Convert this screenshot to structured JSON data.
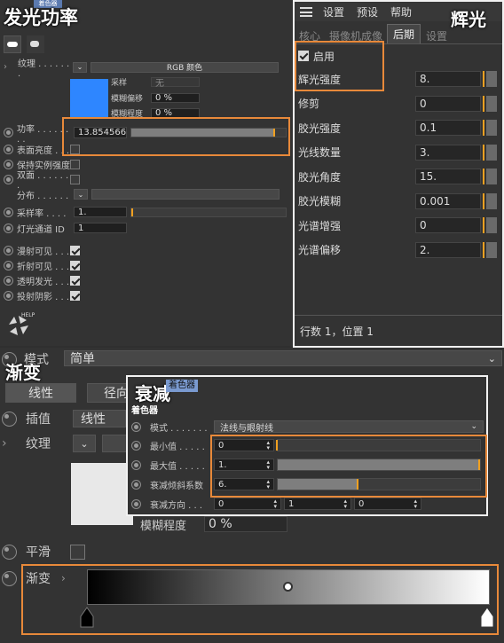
{
  "headings": {
    "glow_power": "发光功率",
    "glow": "辉光",
    "gradient": "渐变",
    "falloff": "衰减"
  },
  "left_panel": {
    "badge": "着色器",
    "texture_label": "纹理 . . . . . . .",
    "texture_mode": "RGB 颜色",
    "sampling_label": "采样",
    "sampling_value": "无",
    "blur_offset_label": "模糊偏移",
    "blur_offset_value": "0 %",
    "blur_degree_label": "模糊程度",
    "blur_degree_value": "0 %",
    "power_label": "功率 . . . . . . . .",
    "power_value": "13.854566",
    "power_level": 0.93,
    "surface_brightness_label": "表面亮度 . . .",
    "keep_instance_label": "保持实例强度",
    "double_side_label": "双面 . . . . . . .",
    "distribution_label": "分布 . . . . . .",
    "sample_rate_label": "采样率 . . . .",
    "sample_rate_value": "1.",
    "light_channel_label": "灯光通道 ID",
    "light_channel_value": "1",
    "diffuse_visible_label": "漫射可见 . . .",
    "refract_visible_label": "折射可见 . . .",
    "transparent_glow_label": "透明发光 . . .",
    "cast_shadow_label": "投射阴影 . . .",
    "help": "HELP",
    "accent_color": "#2e86ff"
  },
  "glow_panel": {
    "menu": [
      "设置",
      "预设",
      "帮助"
    ],
    "tabs": [
      "核心",
      "摄像机成像",
      "后期",
      "设置"
    ],
    "active_tab": "后期",
    "enable_label": "启用",
    "params": [
      {
        "label": "辉光强度",
        "value": "8."
      },
      {
        "label": "修剪",
        "value": "0"
      },
      {
        "label": "胶光强度",
        "value": "0.1"
      },
      {
        "label": "光线数量",
        "value": "3."
      },
      {
        "label": "胶光角度",
        "value": "15."
      },
      {
        "label": "胶光模糊",
        "value": "0.001"
      },
      {
        "label": "光谱增强",
        "value": "0"
      },
      {
        "label": "光谱偏移",
        "value": "2."
      }
    ],
    "status": "行数 1，位置 1"
  },
  "gradient_panel": {
    "mode_label": "模式",
    "mode_value": "简单",
    "linear_tab": "线性",
    "radial_tab": "径向",
    "interp_label": "插值",
    "interp_value": "线性",
    "texture_label": "纹理",
    "blur_degree_label": "模糊程度",
    "blur_degree_value": "0 %",
    "smooth_label": "平滑",
    "gradient_label": "渐变"
  },
  "falloff_panel": {
    "badge": "着色器",
    "title": "着色器",
    "mode_label": "模式 . . . . . . .",
    "mode_value": "法线与眼射线",
    "min_label": "最小值 . . . . .",
    "min_value": "0",
    "min_level": 0.0,
    "max_label": "最大值 . . . . .",
    "max_value": "1.",
    "max_level": 1.0,
    "exp_label": "衰减倾斜系数",
    "exp_value": "6.",
    "exp_level": 0.4,
    "dir_label": "衰减方向 . . .",
    "dir_values": [
      "0",
      "1",
      "0"
    ]
  }
}
